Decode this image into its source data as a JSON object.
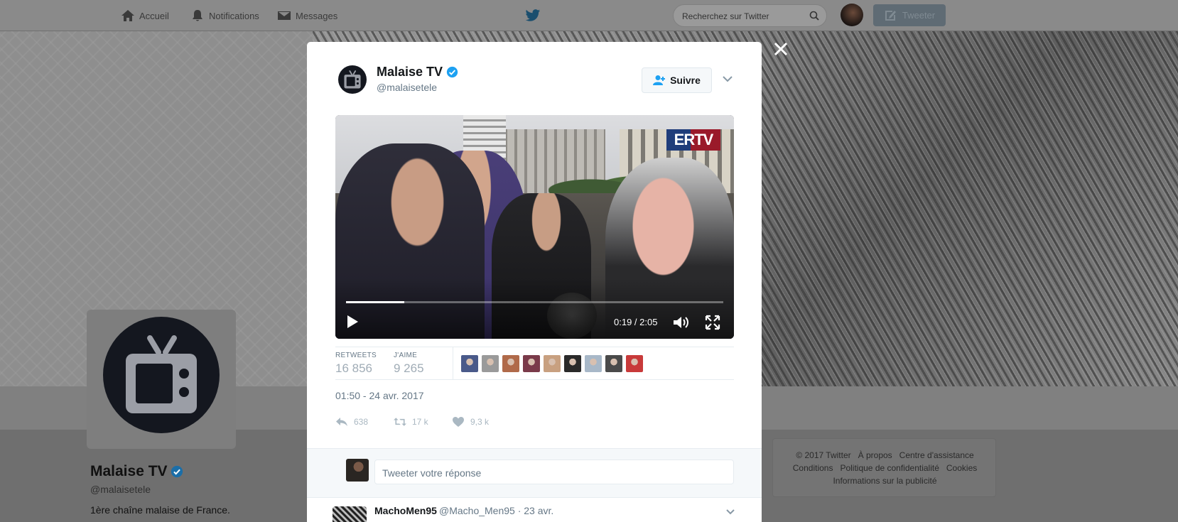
{
  "nav": {
    "home_label": "Accueil",
    "notifications_label": "Notifications",
    "messages_label": "Messages",
    "search_placeholder": "Recherchez sur Twitter",
    "tweet_button_label": "Tweeter"
  },
  "profile": {
    "name": "Malaise TV",
    "handle": "@malaisetele",
    "bio": "1ère chaîne malaise de France."
  },
  "footer": {
    "copyright": "© 2017 Twitter",
    "about": "À propos",
    "help": "Centre d'assistance",
    "terms": "Conditions",
    "privacy": "Politique de confidentialité",
    "cookies": "Cookies",
    "ads_info": "Informations sur la publicité"
  },
  "tweet": {
    "author_name": "Malaise TV",
    "author_handle": "@malaisetele",
    "follow_label": "Suivre",
    "video": {
      "logo_text": "ERTV",
      "time": "0:19 / 2:05",
      "progress": 0.155
    },
    "stats": {
      "retweets_label": "RETWEETS",
      "retweets_value": "16 856",
      "likes_label": "J'AIME",
      "likes_value": "9 265"
    },
    "likers_colors": [
      "#4a5a8a",
      "#9a9a9a",
      "#b06a4a",
      "#7a3a4a",
      "#c8a080",
      "#2a2a2a",
      "#a8b8c8",
      "#4a4a4a",
      "#c83a3a"
    ],
    "timestamp": "01:50 - 24 avr. 2017",
    "actions": {
      "reply_count": "638",
      "retweet_count": "17 k",
      "like_count": "9,3 k"
    }
  },
  "reply": {
    "placeholder": "Tweeter votre réponse"
  },
  "next_tweet": {
    "name": "MachoMen95",
    "meta": "@Macho_Men95 · 23 avr."
  },
  "colors": {
    "verified_blue": "#1da1f2",
    "twitter_blue": "#1da1f2",
    "muted_text": "#657786"
  }
}
